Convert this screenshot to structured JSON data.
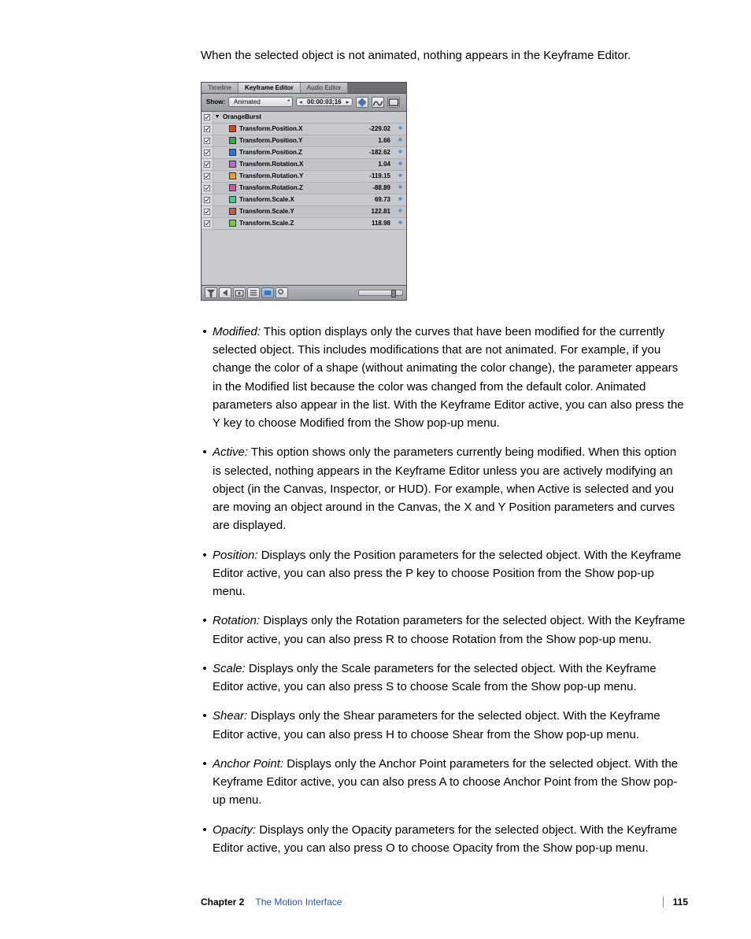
{
  "intro": "When the selected object is not animated, nothing appears in the Keyframe Editor.",
  "kf": {
    "tabs": [
      "Timeline",
      "Keyframe Editor",
      "Audio Editor"
    ],
    "active_tab": 1,
    "show_label": "Show:",
    "show_value": "Animated",
    "timecode": "00:00:03;16",
    "group": "OrangeBurst",
    "rows": [
      {
        "color": "#c44a2a",
        "name": "Transform.Position.X",
        "value": "-229.02"
      },
      {
        "color": "#3fa24a",
        "name": "Transform.Position.Y",
        "value": "1.66"
      },
      {
        "color": "#3a6fc4",
        "name": "Transform.Position.Z",
        "value": "-182.62"
      },
      {
        "color": "#b36fbf",
        "name": "Transform.Rotation.X",
        "value": "1.04"
      },
      {
        "color": "#d8a040",
        "name": "Transform.Rotation.Y",
        "value": "-119.15"
      },
      {
        "color": "#c85da0",
        "name": "Transform.Rotation.Z",
        "value": "-88.89"
      },
      {
        "color": "#58c490",
        "name": "Transform.Scale.X",
        "value": "69.73"
      },
      {
        "color": "#c25a48",
        "name": "Transform.Scale.Y",
        "value": "122.81"
      },
      {
        "color": "#7ac452",
        "name": "Transform.Scale.Z",
        "value": "118.98"
      }
    ]
  },
  "items": [
    {
      "term": "Modified:",
      "body": "This option displays only the curves that have been modified for the currently selected object. This includes modifications that are not animated. For example, if you change the color of a shape (without animating the color change), the parameter appears in the Modified list because the color was changed from the default color. Animated parameters also appear in the list. With the Keyframe Editor active, you can also press the Y key to choose Modified from the Show pop-up menu."
    },
    {
      "term": "Active:",
      "body": "This option shows only the parameters currently being modified. When this option is selected, nothing appears in the Keyframe Editor unless you are actively modifying an object (in the Canvas, Inspector, or HUD). For example, when Active is selected and you are moving an object around in the Canvas, the X and Y Position parameters and curves are displayed."
    },
    {
      "term": "Position:",
      "body": "Displays only the Position parameters for the selected object. With the Keyframe Editor active, you can also press the P key to choose Position from the Show pop-up menu."
    },
    {
      "term": "Rotation:",
      "body": "Displays only the Rotation parameters for the selected object. With the Keyframe Editor active, you can also press R to choose Rotation from the Show pop-up menu."
    },
    {
      "term": "Scale:",
      "body": "Displays only the Scale parameters for the selected object. With the Keyframe Editor active, you can also press S to choose Scale from the Show pop-up menu."
    },
    {
      "term": "Shear:",
      "body": "Displays only the Shear parameters for the selected object. With the Keyframe Editor active, you can also press H to choose Shear from the Show pop-up menu."
    },
    {
      "term": "Anchor Point:",
      "body": "Displays only the Anchor Point parameters for the selected object. With the Keyframe Editor active, you can also press A to choose Anchor Point from the Show pop-up menu."
    },
    {
      "term": "Opacity:",
      "body": "Displays only the Opacity parameters for the selected object. With the Keyframe Editor active, you can also press O to choose Opacity from the Show pop-up menu."
    }
  ],
  "footer": {
    "chapter": "Chapter 2",
    "title": "The Motion Interface",
    "page": "115"
  }
}
